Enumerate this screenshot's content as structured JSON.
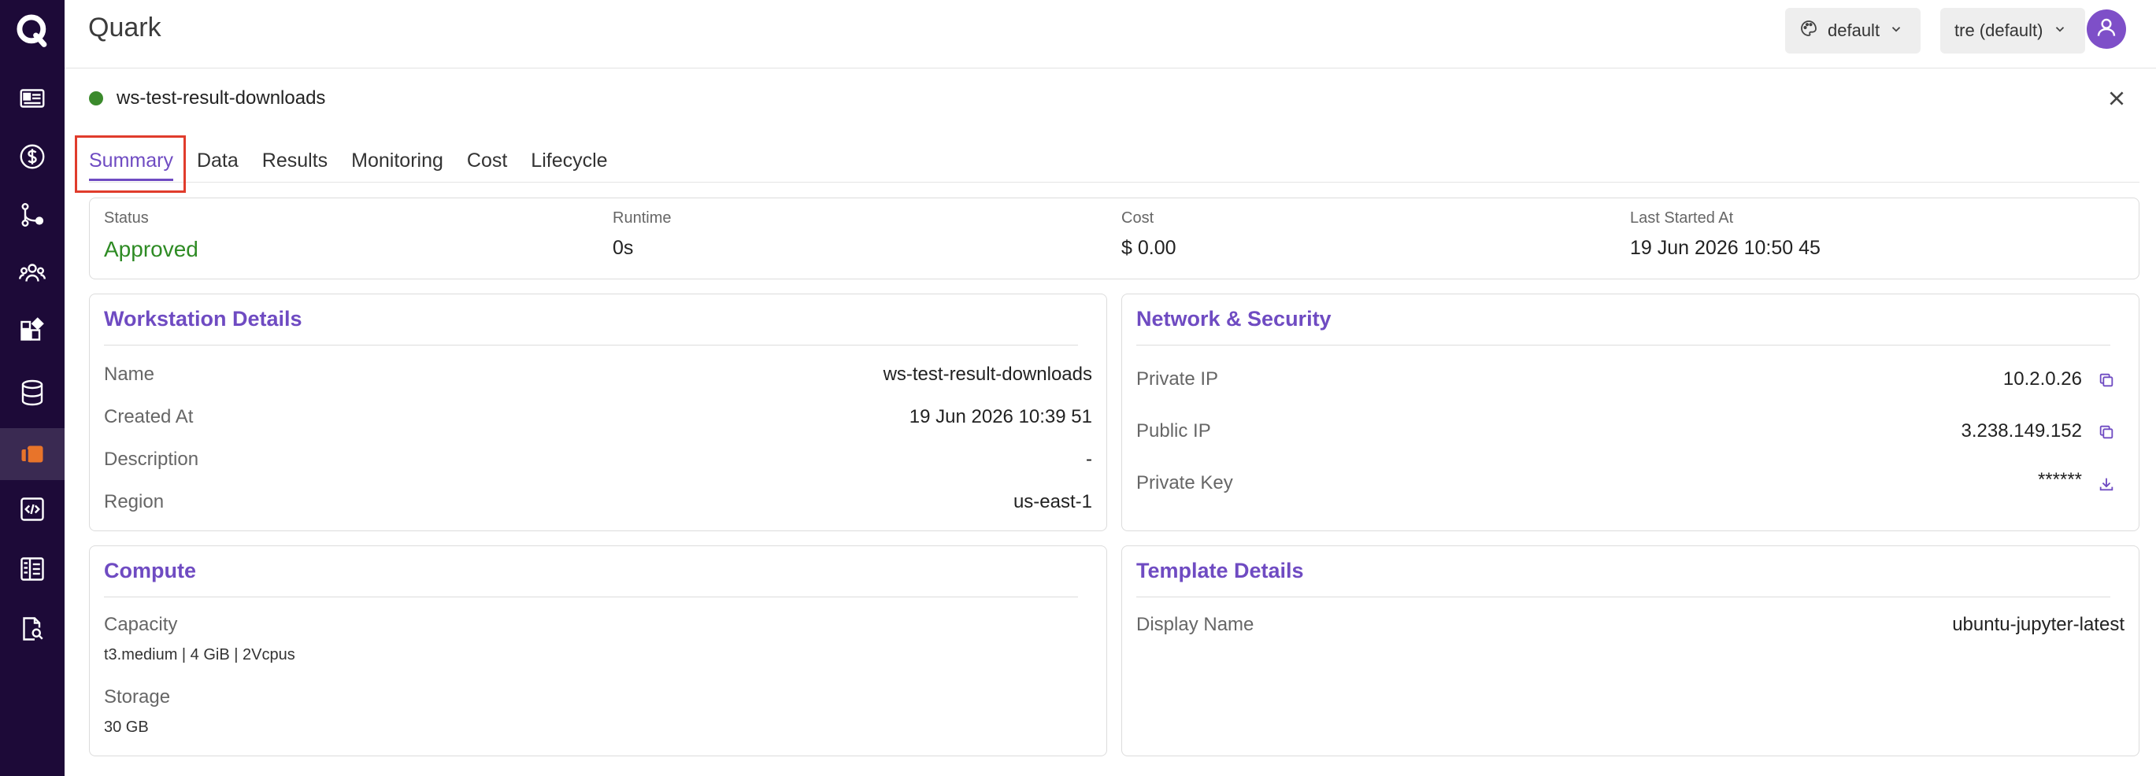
{
  "app": {
    "title": "Quark"
  },
  "header": {
    "theme_select": "default",
    "workspace_select": "tre (default)"
  },
  "sidebar": {
    "items": [
      {
        "name": "dashboard"
      },
      {
        "name": "billing"
      },
      {
        "name": "pipelines"
      },
      {
        "name": "users"
      },
      {
        "name": "apps"
      },
      {
        "name": "database"
      },
      {
        "name": "workstations",
        "active": true
      },
      {
        "name": "code"
      },
      {
        "name": "notebooks"
      },
      {
        "name": "search-docs"
      }
    ]
  },
  "workstation": {
    "name": "ws-test-result-downloads",
    "status_color": "#3b8a2c"
  },
  "tabs": [
    "Summary",
    "Data",
    "Results",
    "Monitoring",
    "Cost",
    "Lifecycle"
  ],
  "summary": {
    "status_label": "Status",
    "status_value": "Approved",
    "runtime_label": "Runtime",
    "runtime_value": "0s",
    "cost_label": "Cost",
    "cost_value": "$ 0.00",
    "last_started_label": "Last Started At",
    "last_started_value": "19 Jun 2026 10:50 45"
  },
  "workstation_details": {
    "title": "Workstation Details",
    "rows": [
      {
        "label": "Name",
        "value": "ws-test-result-downloads"
      },
      {
        "label": "Created At",
        "value": "19 Jun 2026 10:39 51"
      },
      {
        "label": "Description",
        "value": "-"
      },
      {
        "label": "Region",
        "value": "us-east-1"
      }
    ]
  },
  "network": {
    "title": "Network & Security",
    "rows": [
      {
        "label": "Private IP",
        "value": "10.2.0.26",
        "icon": "copy-icon"
      },
      {
        "label": "Public IP",
        "value": "3.238.149.152",
        "icon": "copy-icon"
      },
      {
        "label": "Private Key",
        "value": "******",
        "icon": "download-icon"
      }
    ]
  },
  "compute": {
    "title": "Compute",
    "capacity_label": "Capacity",
    "capacity_value": "t3.medium | 4 GiB | 2Vcpus",
    "storage_label": "Storage",
    "storage_value": "30 GB"
  },
  "template": {
    "title": "Template Details",
    "display_name_label": "Display Name",
    "display_name_value": "ubuntu-jupyter-latest"
  },
  "colors": {
    "sidebar_bg": "#1d0a38",
    "accent": "#6f4bc2",
    "approved": "#2e8b24",
    "highlight": "#e03c2c",
    "active_icon": "#e8742a"
  }
}
